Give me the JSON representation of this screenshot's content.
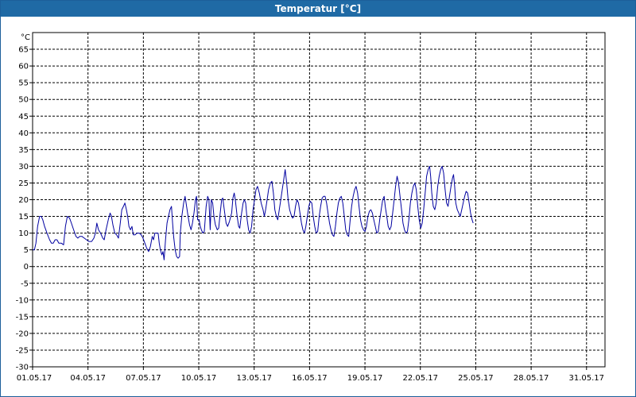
{
  "window": {
    "title": "Temperatur [°C]"
  },
  "chart_data": {
    "type": "line",
    "title": "Temperatur [°C]",
    "unit_label": "°C",
    "xlabel": "",
    "ylabel": "°C",
    "ylim": [
      -30,
      70
    ],
    "yticks": [
      -30,
      -25,
      -20,
      -15,
      -10,
      -5,
      0,
      5,
      10,
      15,
      20,
      25,
      30,
      35,
      40,
      45,
      50,
      55,
      60,
      65
    ],
    "xlim": [
      "01.05.17 00:00",
      "01.06.17 00:00"
    ],
    "xtick_labels": [
      "01.05.17",
      "04.05.17",
      "07.05.17",
      "10.05.17",
      "13.05.17",
      "16.05.17",
      "19.05.17",
      "22.05.17",
      "25.05.17",
      "28.05.17",
      "31.05.17"
    ],
    "grid": true,
    "series": [
      {
        "color": "#0000a0",
        "x_unit": "day of May 2017 (1.0 = 01.05.17 00:00)",
        "points": [
          [
            1.0,
            5
          ],
          [
            1.1,
            5
          ],
          [
            1.18,
            7
          ],
          [
            1.27,
            12
          ],
          [
            1.38,
            15
          ],
          [
            1.47,
            15
          ],
          [
            1.55,
            14
          ],
          [
            1.65,
            12
          ],
          [
            1.78,
            10
          ],
          [
            1.92,
            8
          ],
          [
            2.02,
            7
          ],
          [
            2.12,
            7
          ],
          [
            2.22,
            8
          ],
          [
            2.32,
            8
          ],
          [
            2.42,
            7
          ],
          [
            2.55,
            7
          ],
          [
            2.68,
            6.5
          ],
          [
            2.78,
            12
          ],
          [
            2.88,
            15
          ],
          [
            3.0,
            14.5
          ],
          [
            3.1,
            13
          ],
          [
            3.22,
            11
          ],
          [
            3.35,
            9
          ],
          [
            3.45,
            8.5
          ],
          [
            3.55,
            9
          ],
          [
            3.68,
            9
          ],
          [
            3.8,
            8.5
          ],
          [
            3.92,
            8
          ],
          [
            4.05,
            7.5
          ],
          [
            4.2,
            7.5
          ],
          [
            4.32,
            8.5
          ],
          [
            4.4,
            10
          ],
          [
            4.48,
            13
          ],
          [
            4.57,
            11
          ],
          [
            4.68,
            10
          ],
          [
            4.8,
            8.5
          ],
          [
            4.88,
            8
          ],
          [
            4.98,
            11
          ],
          [
            5.1,
            14
          ],
          [
            5.2,
            16
          ],
          [
            5.27,
            15
          ],
          [
            5.35,
            12.5
          ],
          [
            5.45,
            10
          ],
          [
            5.55,
            9.5
          ],
          [
            5.65,
            8.5
          ],
          [
            5.75,
            13
          ],
          [
            5.83,
            17
          ],
          [
            5.92,
            18
          ],
          [
            6.0,
            19
          ],
          [
            6.08,
            17
          ],
          [
            6.15,
            15
          ],
          [
            6.22,
            12
          ],
          [
            6.3,
            11
          ],
          [
            6.38,
            12
          ],
          [
            6.45,
            9.5
          ],
          [
            6.55,
            9.5
          ],
          [
            6.65,
            10
          ],
          [
            6.78,
            10
          ],
          [
            6.88,
            9.5
          ],
          [
            6.98,
            8.5
          ],
          [
            7.08,
            7
          ],
          [
            7.18,
            5.5
          ],
          [
            7.28,
            4.5
          ],
          [
            7.38,
            6
          ],
          [
            7.48,
            9
          ],
          [
            7.55,
            8
          ],
          [
            7.62,
            10
          ],
          [
            7.72,
            10
          ],
          [
            7.8,
            10
          ],
          [
            7.86,
            7
          ],
          [
            7.92,
            5
          ],
          [
            8.0,
            3.5
          ],
          [
            8.06,
            4.5
          ],
          [
            8.12,
            2
          ],
          [
            8.2,
            8
          ],
          [
            8.28,
            13
          ],
          [
            8.36,
            15
          ],
          [
            8.44,
            17
          ],
          [
            8.52,
            18
          ],
          [
            8.58,
            13
          ],
          [
            8.64,
            9
          ],
          [
            8.72,
            5
          ],
          [
            8.8,
            3
          ],
          [
            8.88,
            2.5
          ],
          [
            8.96,
            3
          ],
          [
            9.0,
            10
          ],
          [
            9.08,
            15
          ],
          [
            9.18,
            19
          ],
          [
            9.26,
            21
          ],
          [
            9.34,
            18
          ],
          [
            9.42,
            15
          ],
          [
            9.5,
            12.5
          ],
          [
            9.58,
            11
          ],
          [
            9.66,
            13
          ],
          [
            9.74,
            16
          ],
          [
            9.82,
            20
          ],
          [
            9.88,
            21
          ],
          [
            9.94,
            14
          ],
          [
            10.02,
            14
          ],
          [
            10.08,
            12
          ],
          [
            10.14,
            11
          ],
          [
            10.22,
            10
          ],
          [
            10.3,
            10.5
          ],
          [
            10.4,
            18
          ],
          [
            10.48,
            21
          ],
          [
            10.55,
            20
          ],
          [
            10.62,
            11
          ],
          [
            10.68,
            20
          ],
          [
            10.75,
            19
          ],
          [
            10.82,
            15
          ],
          [
            10.9,
            12.5
          ],
          [
            11.0,
            11
          ],
          [
            11.08,
            11.5
          ],
          [
            11.16,
            16
          ],
          [
            11.24,
            20
          ],
          [
            11.3,
            20.5
          ],
          [
            11.38,
            17
          ],
          [
            11.48,
            13
          ],
          [
            11.56,
            12
          ],
          [
            11.66,
            13.5
          ],
          [
            11.78,
            16
          ],
          [
            11.85,
            20.5
          ],
          [
            11.92,
            22
          ],
          [
            11.98,
            20
          ],
          [
            12.08,
            15
          ],
          [
            12.16,
            12
          ],
          [
            12.22,
            11.5
          ],
          [
            12.32,
            16
          ],
          [
            12.4,
            19
          ],
          [
            12.47,
            20
          ],
          [
            12.54,
            19
          ],
          [
            12.62,
            14
          ],
          [
            12.7,
            11
          ],
          [
            12.78,
            10
          ],
          [
            12.86,
            12
          ],
          [
            12.94,
            17
          ],
          [
            13.02,
            20
          ],
          [
            13.1,
            23
          ],
          [
            13.18,
            24
          ],
          [
            13.28,
            22
          ],
          [
            13.38,
            19
          ],
          [
            13.48,
            17
          ],
          [
            13.55,
            15
          ],
          [
            13.62,
            17
          ],
          [
            13.7,
            20
          ],
          [
            13.78,
            23
          ],
          [
            13.88,
            25
          ],
          [
            13.96,
            25.5
          ],
          [
            14.04,
            22
          ],
          [
            14.12,
            17
          ],
          [
            14.2,
            15
          ],
          [
            14.28,
            14
          ],
          [
            14.36,
            17
          ],
          [
            14.44,
            20
          ],
          [
            14.52,
            23
          ],
          [
            14.6,
            26
          ],
          [
            14.68,
            29
          ],
          [
            14.76,
            25
          ],
          [
            14.84,
            20
          ],
          [
            14.92,
            17
          ],
          [
            15.0,
            15.5
          ],
          [
            15.08,
            14.5
          ],
          [
            15.16,
            15
          ],
          [
            15.24,
            18
          ],
          [
            15.32,
            20
          ],
          [
            15.4,
            19
          ],
          [
            15.48,
            16
          ],
          [
            15.56,
            13
          ],
          [
            15.64,
            11
          ],
          [
            15.72,
            10
          ],
          [
            15.8,
            12
          ],
          [
            15.88,
            15
          ],
          [
            15.96,
            18
          ],
          [
            16.04,
            19.5
          ],
          [
            16.12,
            19
          ],
          [
            16.2,
            15
          ],
          [
            16.28,
            12
          ],
          [
            16.36,
            10
          ],
          [
            16.44,
            10.5
          ],
          [
            16.52,
            15
          ],
          [
            16.6,
            18
          ],
          [
            16.68,
            20.5
          ],
          [
            16.76,
            21
          ],
          [
            16.84,
            21
          ],
          [
            16.92,
            19
          ],
          [
            17.0,
            16
          ],
          [
            17.08,
            13
          ],
          [
            17.16,
            11
          ],
          [
            17.24,
            9.5
          ],
          [
            17.32,
            9
          ],
          [
            17.4,
            12
          ],
          [
            17.48,
            16
          ],
          [
            17.56,
            19
          ],
          [
            17.64,
            20.5
          ],
          [
            17.72,
            21
          ],
          [
            17.8,
            19
          ],
          [
            17.88,
            15
          ],
          [
            17.96,
            11
          ],
          [
            18.04,
            9.5
          ],
          [
            18.12,
            9
          ],
          [
            18.2,
            14
          ],
          [
            18.28,
            18
          ],
          [
            18.36,
            21
          ],
          [
            18.44,
            23
          ],
          [
            18.52,
            24
          ],
          [
            18.6,
            22
          ],
          [
            18.68,
            18
          ],
          [
            18.76,
            14
          ],
          [
            18.84,
            12
          ],
          [
            18.92,
            11
          ],
          [
            19.0,
            10.5
          ],
          [
            19.08,
            12
          ],
          [
            19.16,
            15
          ],
          [
            19.24,
            16.5
          ],
          [
            19.32,
            17
          ],
          [
            19.4,
            16
          ],
          [
            19.48,
            14
          ],
          [
            19.56,
            12
          ],
          [
            19.64,
            10
          ],
          [
            19.72,
            10.5
          ],
          [
            19.8,
            14
          ],
          [
            19.88,
            17
          ],
          [
            19.96,
            20
          ],
          [
            20.04,
            21
          ],
          [
            20.1,
            18
          ],
          [
            20.18,
            15
          ],
          [
            20.26,
            12
          ],
          [
            20.34,
            11
          ],
          [
            20.42,
            12
          ],
          [
            20.5,
            16
          ],
          [
            20.58,
            20
          ],
          [
            20.66,
            24
          ],
          [
            20.74,
            27
          ],
          [
            20.82,
            25
          ],
          [
            20.9,
            21
          ],
          [
            20.98,
            17
          ],
          [
            21.06,
            13
          ],
          [
            21.14,
            11
          ],
          [
            21.22,
            10
          ],
          [
            21.3,
            10.5
          ],
          [
            21.38,
            14
          ],
          [
            21.46,
            19
          ],
          [
            21.54,
            22
          ],
          [
            21.62,
            24
          ],
          [
            21.7,
            25
          ],
          [
            21.78,
            23
          ],
          [
            21.86,
            18
          ],
          [
            21.94,
            14
          ],
          [
            22.02,
            11.5
          ],
          [
            22.1,
            13
          ],
          [
            22.18,
            17
          ],
          [
            22.26,
            22
          ],
          [
            22.34,
            27
          ],
          [
            22.42,
            29
          ],
          [
            22.5,
            30
          ],
          [
            22.56,
            27
          ],
          [
            22.62,
            22
          ],
          [
            22.7,
            18
          ],
          [
            22.78,
            17
          ],
          [
            22.86,
            19
          ],
          [
            22.94,
            24
          ],
          [
            23.02,
            27
          ],
          [
            23.1,
            29
          ],
          [
            23.18,
            30
          ],
          [
            23.26,
            28
          ],
          [
            23.34,
            23
          ],
          [
            23.42,
            19
          ],
          [
            23.5,
            18
          ],
          [
            23.58,
            21
          ],
          [
            23.66,
            24
          ],
          [
            23.74,
            26.5
          ],
          [
            23.8,
            27.5
          ],
          [
            23.86,
            24
          ],
          [
            23.92,
            19
          ],
          [
            24.0,
            17
          ],
          [
            24.08,
            16
          ],
          [
            24.16,
            15
          ],
          [
            24.24,
            17
          ],
          [
            24.32,
            19
          ],
          [
            24.4,
            21
          ],
          [
            24.48,
            22.5
          ],
          [
            24.56,
            22
          ],
          [
            24.64,
            19
          ],
          [
            24.72,
            16
          ],
          [
            24.8,
            14
          ],
          [
            24.86,
            13
          ]
        ]
      }
    ]
  }
}
